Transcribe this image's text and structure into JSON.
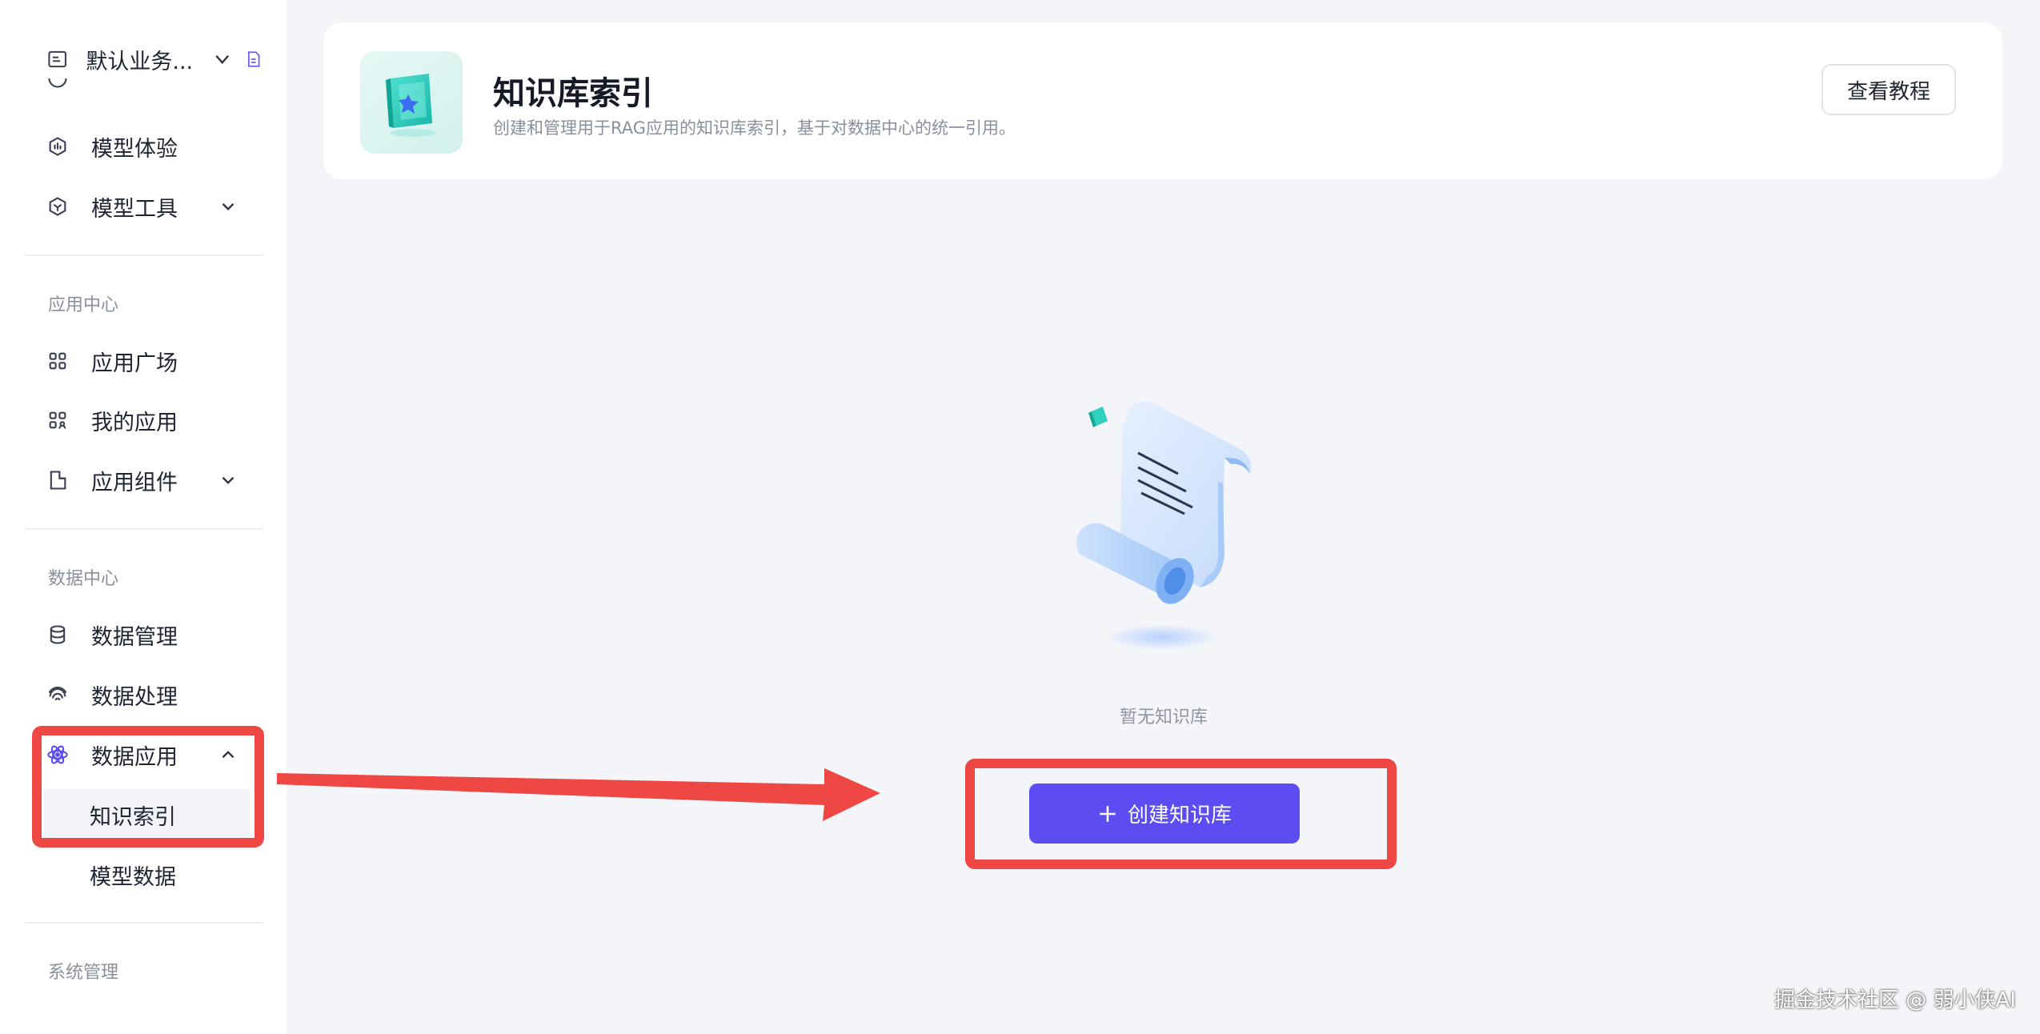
{
  "sidebar": {
    "workspace": {
      "label": "默认业务..."
    },
    "items_top": [
      {
        "label": "模型体验",
        "icon": "model-experience-icon"
      },
      {
        "label": "模型工具",
        "icon": "model-tools-icon"
      }
    ],
    "app_center": {
      "title": "应用中心",
      "items": [
        {
          "label": "应用广场",
          "icon": "grid-icon"
        },
        {
          "label": "我的应用",
          "icon": "my-apps-icon"
        },
        {
          "label": "应用组件",
          "icon": "component-icon"
        }
      ]
    },
    "data_center": {
      "title": "数据中心",
      "items": [
        {
          "label": "数据管理",
          "icon": "database-icon"
        },
        {
          "label": "数据处理",
          "icon": "fingerprint-icon"
        },
        {
          "label": "数据应用",
          "icon": "atom-icon"
        }
      ],
      "sub_items": [
        {
          "label": "知识索引",
          "active": true
        },
        {
          "label": "模型数据",
          "active": false
        }
      ]
    },
    "system": {
      "title": "系统管理"
    }
  },
  "header": {
    "title": "知识库索引",
    "subtitle": "创建和管理用于RAG应用的知识库索引，基于对数据中心的统一引用。",
    "tutorial_button": "查看教程"
  },
  "empty_state": {
    "message": "暂无知识库",
    "create_button": "创建知识库"
  },
  "watermark": "掘金技术社区 @ 弱小侠AI",
  "colors": {
    "accent": "#5b4df2",
    "annotation": "#ef4744",
    "active_icon": "#5b4df2"
  }
}
